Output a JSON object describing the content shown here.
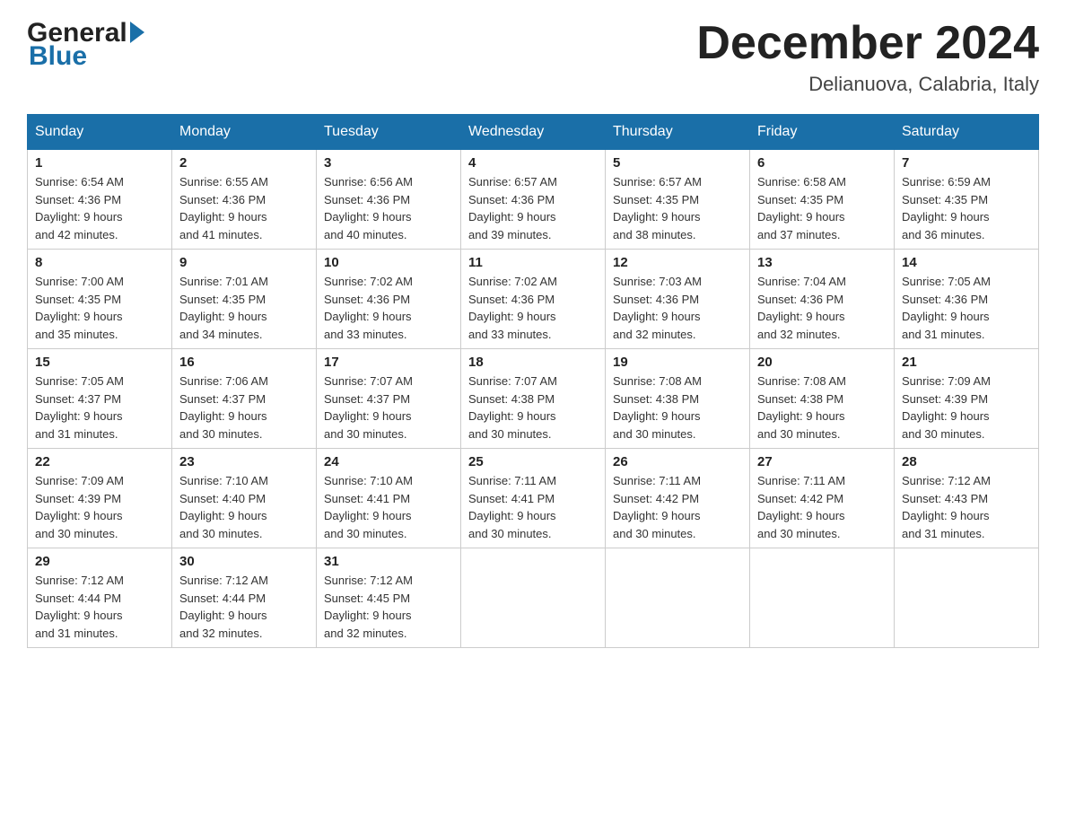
{
  "logo": {
    "general": "General",
    "blue": "Blue"
  },
  "title": "December 2024",
  "location": "Delianuova, Calabria, Italy",
  "weekdays": [
    "Sunday",
    "Monday",
    "Tuesday",
    "Wednesday",
    "Thursday",
    "Friday",
    "Saturday"
  ],
  "weeks": [
    [
      {
        "day": "1",
        "sunrise": "6:54 AM",
        "sunset": "4:36 PM",
        "daylight": "9 hours and 42 minutes."
      },
      {
        "day": "2",
        "sunrise": "6:55 AM",
        "sunset": "4:36 PM",
        "daylight": "9 hours and 41 minutes."
      },
      {
        "day": "3",
        "sunrise": "6:56 AM",
        "sunset": "4:36 PM",
        "daylight": "9 hours and 40 minutes."
      },
      {
        "day": "4",
        "sunrise": "6:57 AM",
        "sunset": "4:36 PM",
        "daylight": "9 hours and 39 minutes."
      },
      {
        "day": "5",
        "sunrise": "6:57 AM",
        "sunset": "4:35 PM",
        "daylight": "9 hours and 38 minutes."
      },
      {
        "day": "6",
        "sunrise": "6:58 AM",
        "sunset": "4:35 PM",
        "daylight": "9 hours and 37 minutes."
      },
      {
        "day": "7",
        "sunrise": "6:59 AM",
        "sunset": "4:35 PM",
        "daylight": "9 hours and 36 minutes."
      }
    ],
    [
      {
        "day": "8",
        "sunrise": "7:00 AM",
        "sunset": "4:35 PM",
        "daylight": "9 hours and 35 minutes."
      },
      {
        "day": "9",
        "sunrise": "7:01 AM",
        "sunset": "4:35 PM",
        "daylight": "9 hours and 34 minutes."
      },
      {
        "day": "10",
        "sunrise": "7:02 AM",
        "sunset": "4:36 PM",
        "daylight": "9 hours and 33 minutes."
      },
      {
        "day": "11",
        "sunrise": "7:02 AM",
        "sunset": "4:36 PM",
        "daylight": "9 hours and 33 minutes."
      },
      {
        "day": "12",
        "sunrise": "7:03 AM",
        "sunset": "4:36 PM",
        "daylight": "9 hours and 32 minutes."
      },
      {
        "day": "13",
        "sunrise": "7:04 AM",
        "sunset": "4:36 PM",
        "daylight": "9 hours and 32 minutes."
      },
      {
        "day": "14",
        "sunrise": "7:05 AM",
        "sunset": "4:36 PM",
        "daylight": "9 hours and 31 minutes."
      }
    ],
    [
      {
        "day": "15",
        "sunrise": "7:05 AM",
        "sunset": "4:37 PM",
        "daylight": "9 hours and 31 minutes."
      },
      {
        "day": "16",
        "sunrise": "7:06 AM",
        "sunset": "4:37 PM",
        "daylight": "9 hours and 30 minutes."
      },
      {
        "day": "17",
        "sunrise": "7:07 AM",
        "sunset": "4:37 PM",
        "daylight": "9 hours and 30 minutes."
      },
      {
        "day": "18",
        "sunrise": "7:07 AM",
        "sunset": "4:38 PM",
        "daylight": "9 hours and 30 minutes."
      },
      {
        "day": "19",
        "sunrise": "7:08 AM",
        "sunset": "4:38 PM",
        "daylight": "9 hours and 30 minutes."
      },
      {
        "day": "20",
        "sunrise": "7:08 AM",
        "sunset": "4:38 PM",
        "daylight": "9 hours and 30 minutes."
      },
      {
        "day": "21",
        "sunrise": "7:09 AM",
        "sunset": "4:39 PM",
        "daylight": "9 hours and 30 minutes."
      }
    ],
    [
      {
        "day": "22",
        "sunrise": "7:09 AM",
        "sunset": "4:39 PM",
        "daylight": "9 hours and 30 minutes."
      },
      {
        "day": "23",
        "sunrise": "7:10 AM",
        "sunset": "4:40 PM",
        "daylight": "9 hours and 30 minutes."
      },
      {
        "day": "24",
        "sunrise": "7:10 AM",
        "sunset": "4:41 PM",
        "daylight": "9 hours and 30 minutes."
      },
      {
        "day": "25",
        "sunrise": "7:11 AM",
        "sunset": "4:41 PM",
        "daylight": "9 hours and 30 minutes."
      },
      {
        "day": "26",
        "sunrise": "7:11 AM",
        "sunset": "4:42 PM",
        "daylight": "9 hours and 30 minutes."
      },
      {
        "day": "27",
        "sunrise": "7:11 AM",
        "sunset": "4:42 PM",
        "daylight": "9 hours and 30 minutes."
      },
      {
        "day": "28",
        "sunrise": "7:12 AM",
        "sunset": "4:43 PM",
        "daylight": "9 hours and 31 minutes."
      }
    ],
    [
      {
        "day": "29",
        "sunrise": "7:12 AM",
        "sunset": "4:44 PM",
        "daylight": "9 hours and 31 minutes."
      },
      {
        "day": "30",
        "sunrise": "7:12 AM",
        "sunset": "4:44 PM",
        "daylight": "9 hours and 32 minutes."
      },
      {
        "day": "31",
        "sunrise": "7:12 AM",
        "sunset": "4:45 PM",
        "daylight": "9 hours and 32 minutes."
      },
      null,
      null,
      null,
      null
    ]
  ],
  "labels": {
    "sunrise": "Sunrise: ",
    "sunset": "Sunset: ",
    "daylight": "Daylight: "
  }
}
